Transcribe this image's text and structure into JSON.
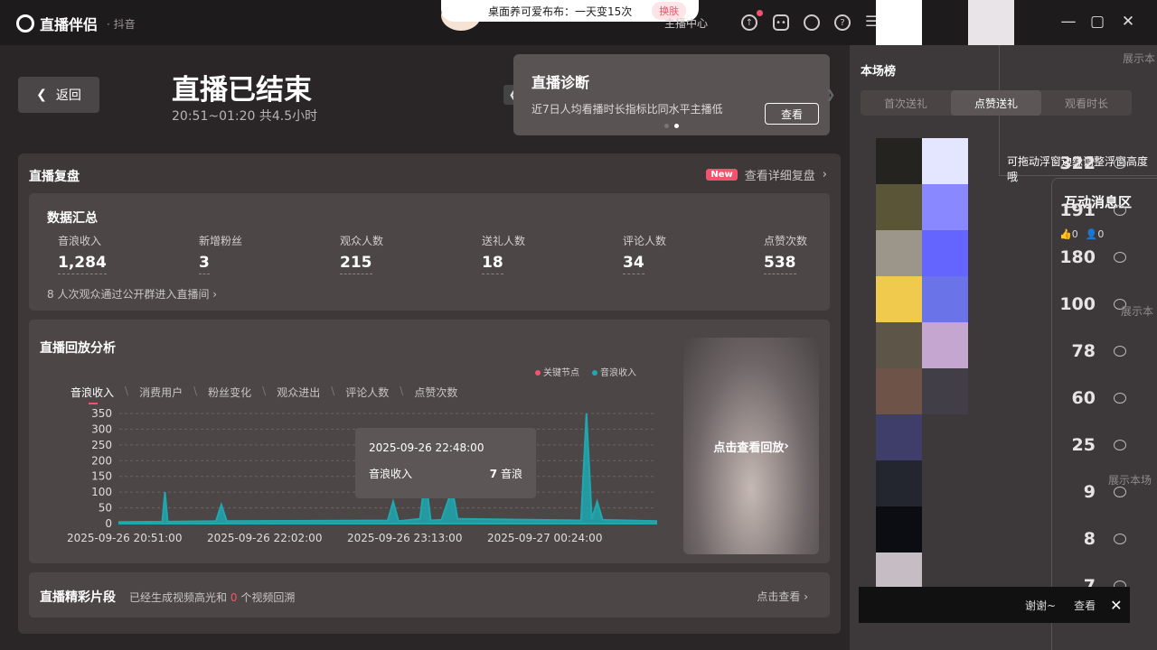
{
  "app": {
    "name": "直播伴侣",
    "platform": "· 抖音",
    "anchor_center": "主播中心"
  },
  "notification": {
    "text": "桌面养可爱布布：一天变15次",
    "button": "换肤"
  },
  "header": {
    "back_label": "返回",
    "title": "直播已结束",
    "subtitle": "20:51~01:20 共4.5小时"
  },
  "diagnosis": {
    "title": "直播诊断",
    "text": "近7日人均看播时长指标比同水平主播低",
    "button": "查看"
  },
  "review": {
    "title": "直播复盘",
    "new_badge": "New",
    "detail_link": "查看详细复盘"
  },
  "summary": {
    "title": "数据汇总",
    "metrics": [
      {
        "label": "音浪收入",
        "value": "1,284"
      },
      {
        "label": "新增粉丝",
        "value": "3"
      },
      {
        "label": "观众人数",
        "value": "215"
      },
      {
        "label": "送礼人数",
        "value": "18"
      },
      {
        "label": "评论人数",
        "value": "34"
      },
      {
        "label": "点赞次数",
        "value": "538"
      }
    ],
    "footer": "8 人次观众通过公开群进入直播间"
  },
  "replay": {
    "title": "直播回放分析",
    "legend_key": "关键节点",
    "legend_income": "音浪收入",
    "tabs": [
      "音浪收入",
      "消费用户",
      "粉丝变化",
      "观众进出",
      "评论人数",
      "点赞次数"
    ],
    "thumb_label": "点击查看回放",
    "tooltip": {
      "time": "2025-09-26 22:48:00",
      "label": "音浪收入",
      "value": "7",
      "unit": "音浪"
    }
  },
  "chart_data": {
    "type": "area",
    "x": [
      "2025-09-26 20:51:00",
      "2025-09-26 22:02:00",
      "2025-09-26 23:13:00",
      "2025-09-27 00:24:00"
    ],
    "ylim": [
      0,
      350
    ],
    "yticks": [
      350,
      300,
      250,
      200,
      150,
      100,
      50,
      0
    ],
    "series": [
      {
        "name": "音浪收入",
        "color": "#1fa8b0",
        "points": [
          [
            0,
            5
          ],
          [
            0.08,
            6
          ],
          [
            0.085,
            100
          ],
          [
            0.09,
            6
          ],
          [
            0.18,
            8
          ],
          [
            0.19,
            60
          ],
          [
            0.2,
            8
          ],
          [
            0.5,
            10
          ],
          [
            0.51,
            70
          ],
          [
            0.52,
            8
          ],
          [
            0.56,
            15
          ],
          [
            0.57,
            150
          ],
          [
            0.58,
            10
          ],
          [
            0.6,
            12
          ],
          [
            0.62,
            110
          ],
          [
            0.63,
            15
          ],
          [
            0.86,
            10
          ],
          [
            0.87,
            350
          ],
          [
            0.88,
            15
          ],
          [
            0.89,
            70
          ],
          [
            0.9,
            12
          ],
          [
            1,
            8
          ]
        ]
      }
    ],
    "grid": true
  },
  "highlights": {
    "title": "直播精彩片段",
    "text_prefix": "已经生成视频高光和",
    "count": "0",
    "text_suffix": "个视频回溯",
    "link": "点击查看"
  },
  "ranking": {
    "title": "本场榜",
    "tabs": [
      "首次送礼",
      "点赞送礼",
      "观看时长"
    ],
    "active_tab": 1
  },
  "float_hint": "可拖动浮窗边缘调整浮窗高度哦",
  "messages": {
    "title": "互动消息区",
    "likes": "0",
    "users": "0"
  },
  "counts": [
    "322",
    "191",
    "180",
    "100",
    "78",
    "60",
    "25",
    "9",
    "8",
    "7"
  ],
  "side_hints": [
    "展示本",
    "展示本",
    "展示本场"
  ],
  "bottom_bar": {
    "text": "谢谢~",
    "button": "查看"
  },
  "colors": {
    "accent": "#f1546c",
    "teal": "#1fa8b0"
  }
}
